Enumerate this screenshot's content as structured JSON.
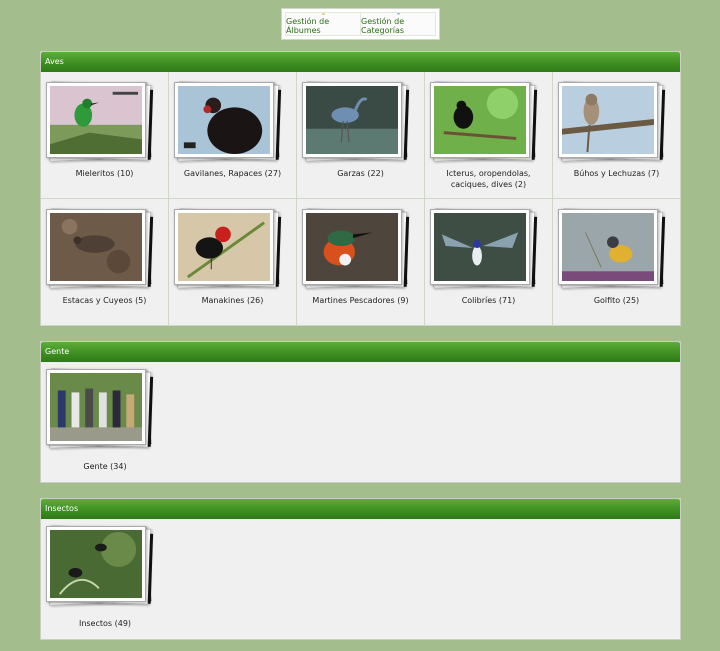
{
  "toolbar": {
    "albums_label": "Gestión de Álbumes",
    "categories_label": "Gestión de Categorías"
  },
  "sections": [
    {
      "title": "Aves",
      "albums": [
        {
          "label": "Mieleritos (10)"
        },
        {
          "label": "Gavilanes, Rapaces (27)"
        },
        {
          "label": "Garzas (22)"
        },
        {
          "label": "Icterus, oropendolas, caciques, dives (2)"
        },
        {
          "label": "Búhos y Lechuzas (7)"
        },
        {
          "label": "Estacas y Cuyeos (5)"
        },
        {
          "label": "Manakines (26)"
        },
        {
          "label": "Martines Pescadores (9)"
        },
        {
          "label": "Colibríes (71)"
        },
        {
          "label": "Golfito (25)"
        }
      ]
    },
    {
      "title": "Gente",
      "albums": [
        {
          "label": "Gente (34)"
        }
      ]
    },
    {
      "title": "Insectos",
      "albums": [
        {
          "label": "Insectos (49)"
        }
      ]
    }
  ],
  "colors": {
    "page_bg": "#a3bd8c",
    "header_green": "#3f8f22",
    "panel_bg": "#f0f0f0"
  }
}
